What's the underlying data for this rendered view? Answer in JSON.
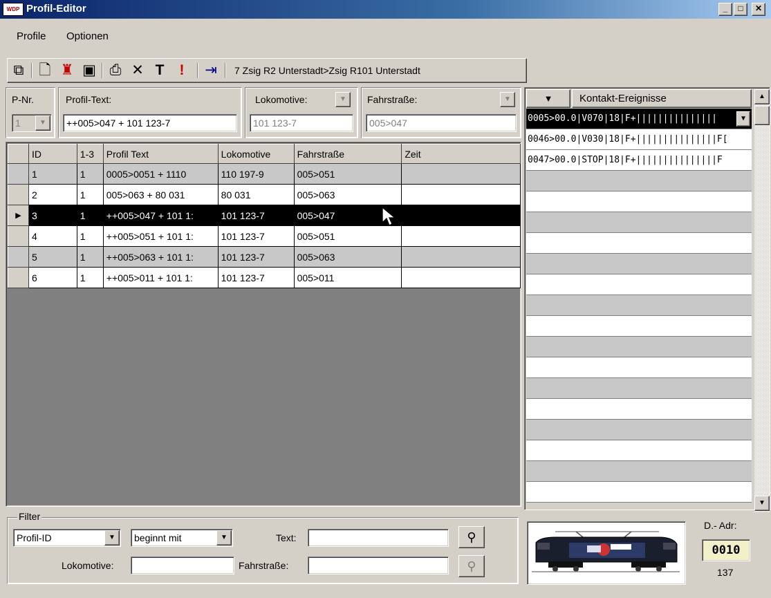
{
  "window": {
    "title": "Profil-Editor",
    "icon_text": "WDP",
    "min": "_",
    "max": "□",
    "close": "✕"
  },
  "menubar": {
    "items": [
      "Profile",
      "Optionen"
    ]
  },
  "toolbar": {
    "path_text": "7 Zsig R2 Unterstadt>Zsig R101 Unterstadt",
    "icons": [
      "window-icon",
      "new-page-icon",
      "stamp-icon",
      "save-icon",
      "print-icon",
      "delete-icon",
      "text-check-icon",
      "warning-icon",
      "exit-icon"
    ]
  },
  "header": {
    "pnr_label": "P-Nr.",
    "pnr_value": "1",
    "profiltext_label": "Profil-Text:",
    "profiltext_value": "++005>047 + 101 123-7",
    "lokomotive_label": "Lokomotive:",
    "lokomotive_value": "101 123-7",
    "fahrstrasse_label": "Fahrstraße:",
    "fahrstrasse_value": "005>047"
  },
  "grid": {
    "columns": [
      "",
      "ID",
      "1-3",
      "Profil Text",
      "Lokomotive",
      "Fahrstraße",
      "Zeit"
    ],
    "rows": [
      {
        "id": "1",
        "n": "1",
        "text": "0005>0051 + 1110 ",
        "loco": "110 197-9",
        "route": "005>051",
        "zeit": ""
      },
      {
        "id": "2",
        "n": "1",
        "text": "005>063 + 80 031",
        "loco": "80 031",
        "route": "005>063",
        "zeit": ""
      },
      {
        "id": "3",
        "n": "1",
        "text": "++005>047 + 101 1:",
        "loco": "101 123-7",
        "route": "005>047",
        "zeit": ""
      },
      {
        "id": "4",
        "n": "1",
        "text": "++005>051 + 101 1:",
        "loco": "101 123-7",
        "route": "005>051",
        "zeit": ""
      },
      {
        "id": "5",
        "n": "1",
        "text": "++005>063 + 101 1:",
        "loco": "101 123-7",
        "route": "005>063",
        "zeit": ""
      },
      {
        "id": "6",
        "n": "1",
        "text": "++005>011 + 101 1:",
        "loco": "101 123-7",
        "route": "005>011",
        "zeit": ""
      }
    ],
    "selected_row": "3",
    "current_marker": "▶"
  },
  "events": {
    "header": "Kontakt-Ereignisse",
    "items": [
      "0005>00.0|V070|18|F+|||||||||||||||",
      "0046>00.0|V030|18|F+|||||||||||||||F[",
      "0047>00.0|STOP|18|F+|||||||||||||||F"
    ]
  },
  "filter": {
    "legend": "Filter",
    "field_value": "Profil-ID",
    "mode_value": "beginnt mit",
    "text_label": "Text:",
    "text_value": "",
    "lokomotive_label": "Lokomotive:",
    "lokomotive_value": "",
    "fahrstrasse_label": "Fahrstraße:",
    "fahrstrasse_value": ""
  },
  "decoder": {
    "label": "D.- Adr:",
    "value": "0010",
    "sub": "137"
  }
}
